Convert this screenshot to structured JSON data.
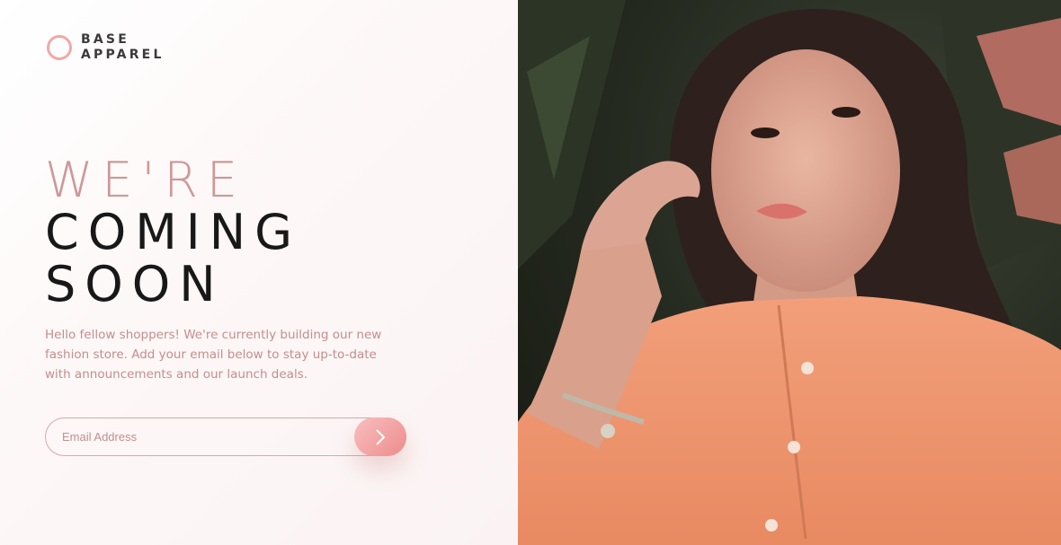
{
  "brand": {
    "line1": "BASE",
    "line2": "APPAREL"
  },
  "headline": {
    "light": "WE'RE",
    "dark1": "COMING",
    "dark2": "SOON"
  },
  "description": "Hello fellow shoppers! We're currently building our new fashion store. Add your email below to stay up-to-date with announcements and our launch deals.",
  "form": {
    "email_placeholder": "Email Address",
    "submit_icon": "chevron-right-icon"
  },
  "hero": {
    "subject": "hero-photo-woman"
  },
  "colors": {
    "accent": "#ce9797",
    "button_start": "#f8bfbf",
    "button_end": "#ee8b8b",
    "text_dark": "#181818"
  }
}
